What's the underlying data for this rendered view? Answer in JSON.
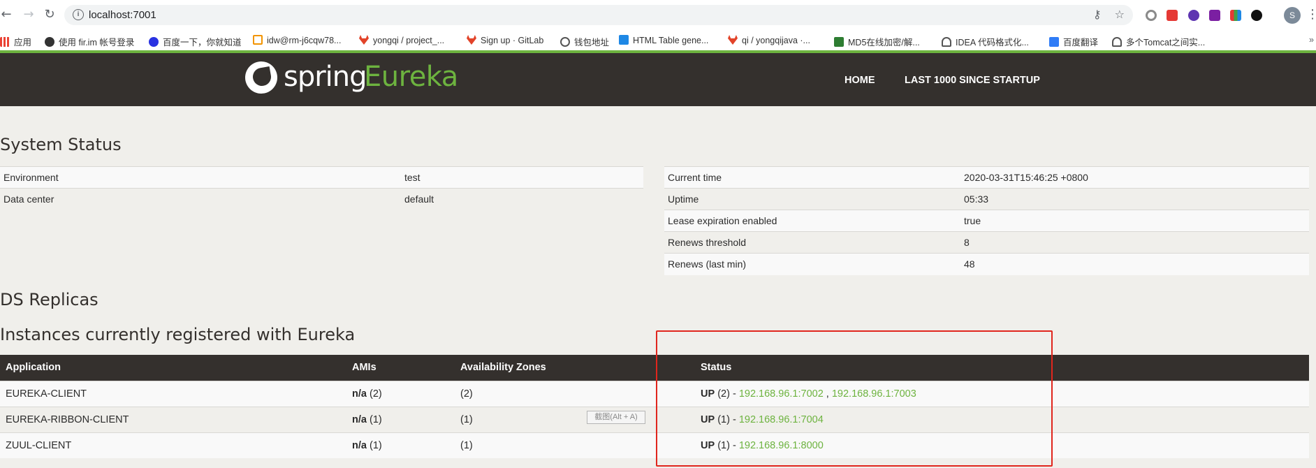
{
  "browser": {
    "url": "localhost:7001",
    "bookmarks": [
      {
        "label": "应用",
        "color": "#ea4335"
      },
      {
        "label": "使用 fir.im 帐号登录",
        "color": "#333333"
      },
      {
        "label": "百度一下，你就知道",
        "color": "#2932e1"
      },
      {
        "label": "idw@rm-j6cqw78...",
        "color": "#f29400"
      },
      {
        "label": "yongqi / project_...",
        "color": "#e24329"
      },
      {
        "label": "Sign up · GitLab",
        "color": "#e24329"
      },
      {
        "label": "钱包地址",
        "color": "#333333"
      },
      {
        "label": "HTML Table gene...",
        "color": "#1e88e5"
      },
      {
        "label": "qi / yongqijava ·...",
        "color": "#e24329"
      },
      {
        "label": "MD5在线加密/解...",
        "color": "#2e7d32"
      },
      {
        "label": "IDEA 代码格式化...",
        "color": "#333333"
      },
      {
        "label": "百度翻译",
        "color": "#2f7cf6"
      },
      {
        "label": "多个Tomcat之间实...",
        "color": "#333333"
      }
    ],
    "avatar_letter": "S"
  },
  "header": {
    "logo_spring": "spring",
    "logo_eureka": "Eureka",
    "nav": {
      "home": "HOME",
      "last": "LAST 1000 SINCE STARTUP"
    },
    "accent": "#6db33f",
    "bg": "#34302d"
  },
  "system_status": {
    "title": "System Status",
    "left": [
      {
        "k": "Environment",
        "v": "test"
      },
      {
        "k": "Data center",
        "v": "default"
      }
    ],
    "right": [
      {
        "k": "Current time",
        "v": "2020-03-31T15:46:25 +0800"
      },
      {
        "k": "Uptime",
        "v": "05:33"
      },
      {
        "k": "Lease expiration enabled",
        "v": "true"
      },
      {
        "k": "Renews threshold",
        "v": "8"
      },
      {
        "k": "Renews (last min)",
        "v": "48"
      }
    ]
  },
  "ds_replicas": {
    "title": "DS Replicas"
  },
  "instances": {
    "title": "Instances currently registered with Eureka",
    "columns": [
      "Application",
      "AMIs",
      "Availability Zones",
      "Status"
    ],
    "rows": [
      {
        "app": "EUREKA-CLIENT",
        "ami_na": "n/a",
        "ami_count": "(2)",
        "zones": "(2)",
        "status_up": "UP",
        "status_count": "(2) -",
        "link1": "192.168.96.1:7002",
        "sep": ",",
        "link2": "192.168.96.1:7003"
      },
      {
        "app": "EUREKA-RIBBON-CLIENT",
        "ami_na": "n/a",
        "ami_count": "(1)",
        "zones": "(1)",
        "status_up": "UP",
        "status_count": "(1) -",
        "link1": "192.168.96.1:7004"
      },
      {
        "app": "ZUUL-CLIENT",
        "ami_na": "n/a",
        "ami_count": "(1)",
        "zones": "(1)",
        "status_up": "UP",
        "status_count": "(1) -",
        "link1": "192.168.96.1:8000"
      }
    ]
  },
  "tooltip": "截图(Alt + A)"
}
